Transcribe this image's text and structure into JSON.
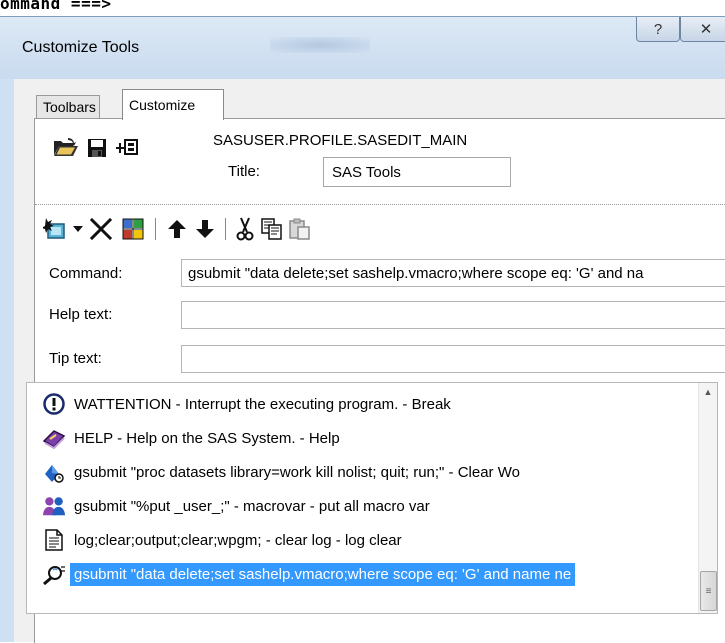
{
  "background_text": "ommand ===>",
  "window": {
    "title": "Customize Tools",
    "help_glyph": "?",
    "close_glyph": "✕"
  },
  "tabs": [
    {
      "label": "Toolbars",
      "active": false
    },
    {
      "label": "Customize",
      "active": true
    }
  ],
  "profile_name": "SASUSER.PROFILE.SASEDIT_MAIN",
  "title_field": {
    "label": "Title:",
    "value": "SAS Tools"
  },
  "toolbar_icons": [
    "add-tool-icon",
    "dropdown-arrow-icon",
    "delete-icon",
    "change-icon-icon",
    "move-up-icon",
    "move-down-icon",
    "cut-icon",
    "copy-icon",
    "paste-icon"
  ],
  "command_field": {
    "label": "Command:",
    "value": "gsubmit \"data delete;set sashelp.vmacro;where scope eq: 'G' and na"
  },
  "help_text_field": {
    "label": "Help text:",
    "value": ""
  },
  "tip_text_field": {
    "label": "Tip text:",
    "value": ""
  },
  "tool_list": [
    {
      "icon": "attention-icon",
      "text": "WATTENTION - Interrupt the executing program. - Break"
    },
    {
      "icon": "help-book-icon",
      "text": "HELP - Help on the SAS System. - Help"
    },
    {
      "icon": "dataset-clear-icon",
      "text": "gsubmit \"proc datasets library=work kill nolist; quit; run;\" - Clear Wo"
    },
    {
      "icon": "users-icon",
      "text": "gsubmit \"%put _user_;\" - macrovar - put all macro var"
    },
    {
      "icon": "document-icon",
      "text": "log;clear;output;clear;wpgm; - clear log - log clear"
    },
    {
      "icon": "magnifier-icon",
      "text": "gsubmit \"data delete;set sashelp.vmacro;where scope eq: 'G' and name ne",
      "selected": true
    }
  ],
  "colors": {
    "selection": "#3399ff",
    "titlebar": "#cfe0f3"
  }
}
